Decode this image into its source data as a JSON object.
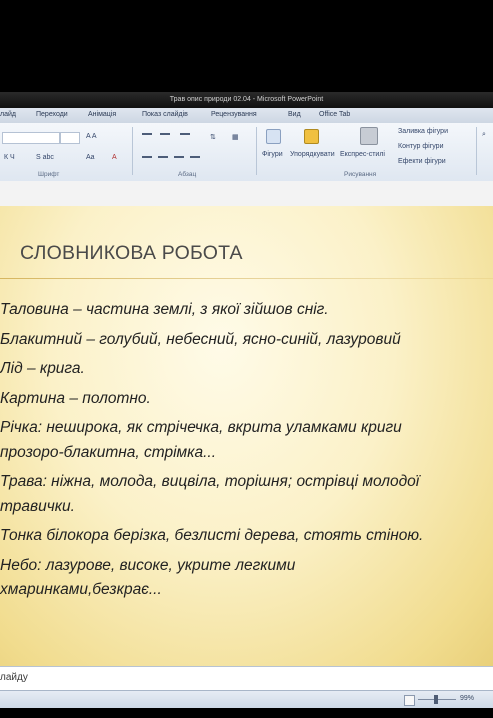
{
  "window": {
    "title": "Трав опис природи 02.04 - Microsoft PowerPoint"
  },
  "ribbon": {
    "tabs": [
      "лайд",
      "Переходи",
      "Анімація",
      "Показ слайдів",
      "Рецензування",
      "Вид",
      "Office Tab"
    ],
    "groups": {
      "font_label": "Шрифт",
      "paragraph_label": "Абзац",
      "drawing_label": "Рисування"
    },
    "buttons": {
      "shapes": "Фігури",
      "arrange": "Упорядкувати",
      "quick_styles": "Експрес-стилі",
      "shape_fill": "Заливка фігури",
      "shape_outline": "Контур фігури",
      "shape_effects": "Ефекти фігури"
    }
  },
  "slide": {
    "title": "СЛОВНИКОВА РОБОТА",
    "paragraphs": [
      [
        "Таловина – частина землі, з якої зійшов сніг."
      ],
      [
        "Блакитний – голубий, небесний, ясно-синій, лазуровий"
      ],
      [
        "Лід – крига."
      ],
      [
        "Картина – полотно."
      ],
      [
        "Річка: неширока, як стрічечка, вкрита уламками криги",
        "прозоро-блакитна, стрімка..."
      ],
      [
        "Трава: ніжна, молода, вицвіла, торішня; острівці молодої",
        "травички."
      ],
      [
        "Тонка білокора берізка, безлисті дерева, стоять стіною."
      ],
      [
        "Небо: лазурове, високе, укрите легкими",
        "хмаринками,безкрає..."
      ]
    ]
  },
  "notes": {
    "text": "лайду"
  },
  "status": {
    "zoom": "99%"
  }
}
